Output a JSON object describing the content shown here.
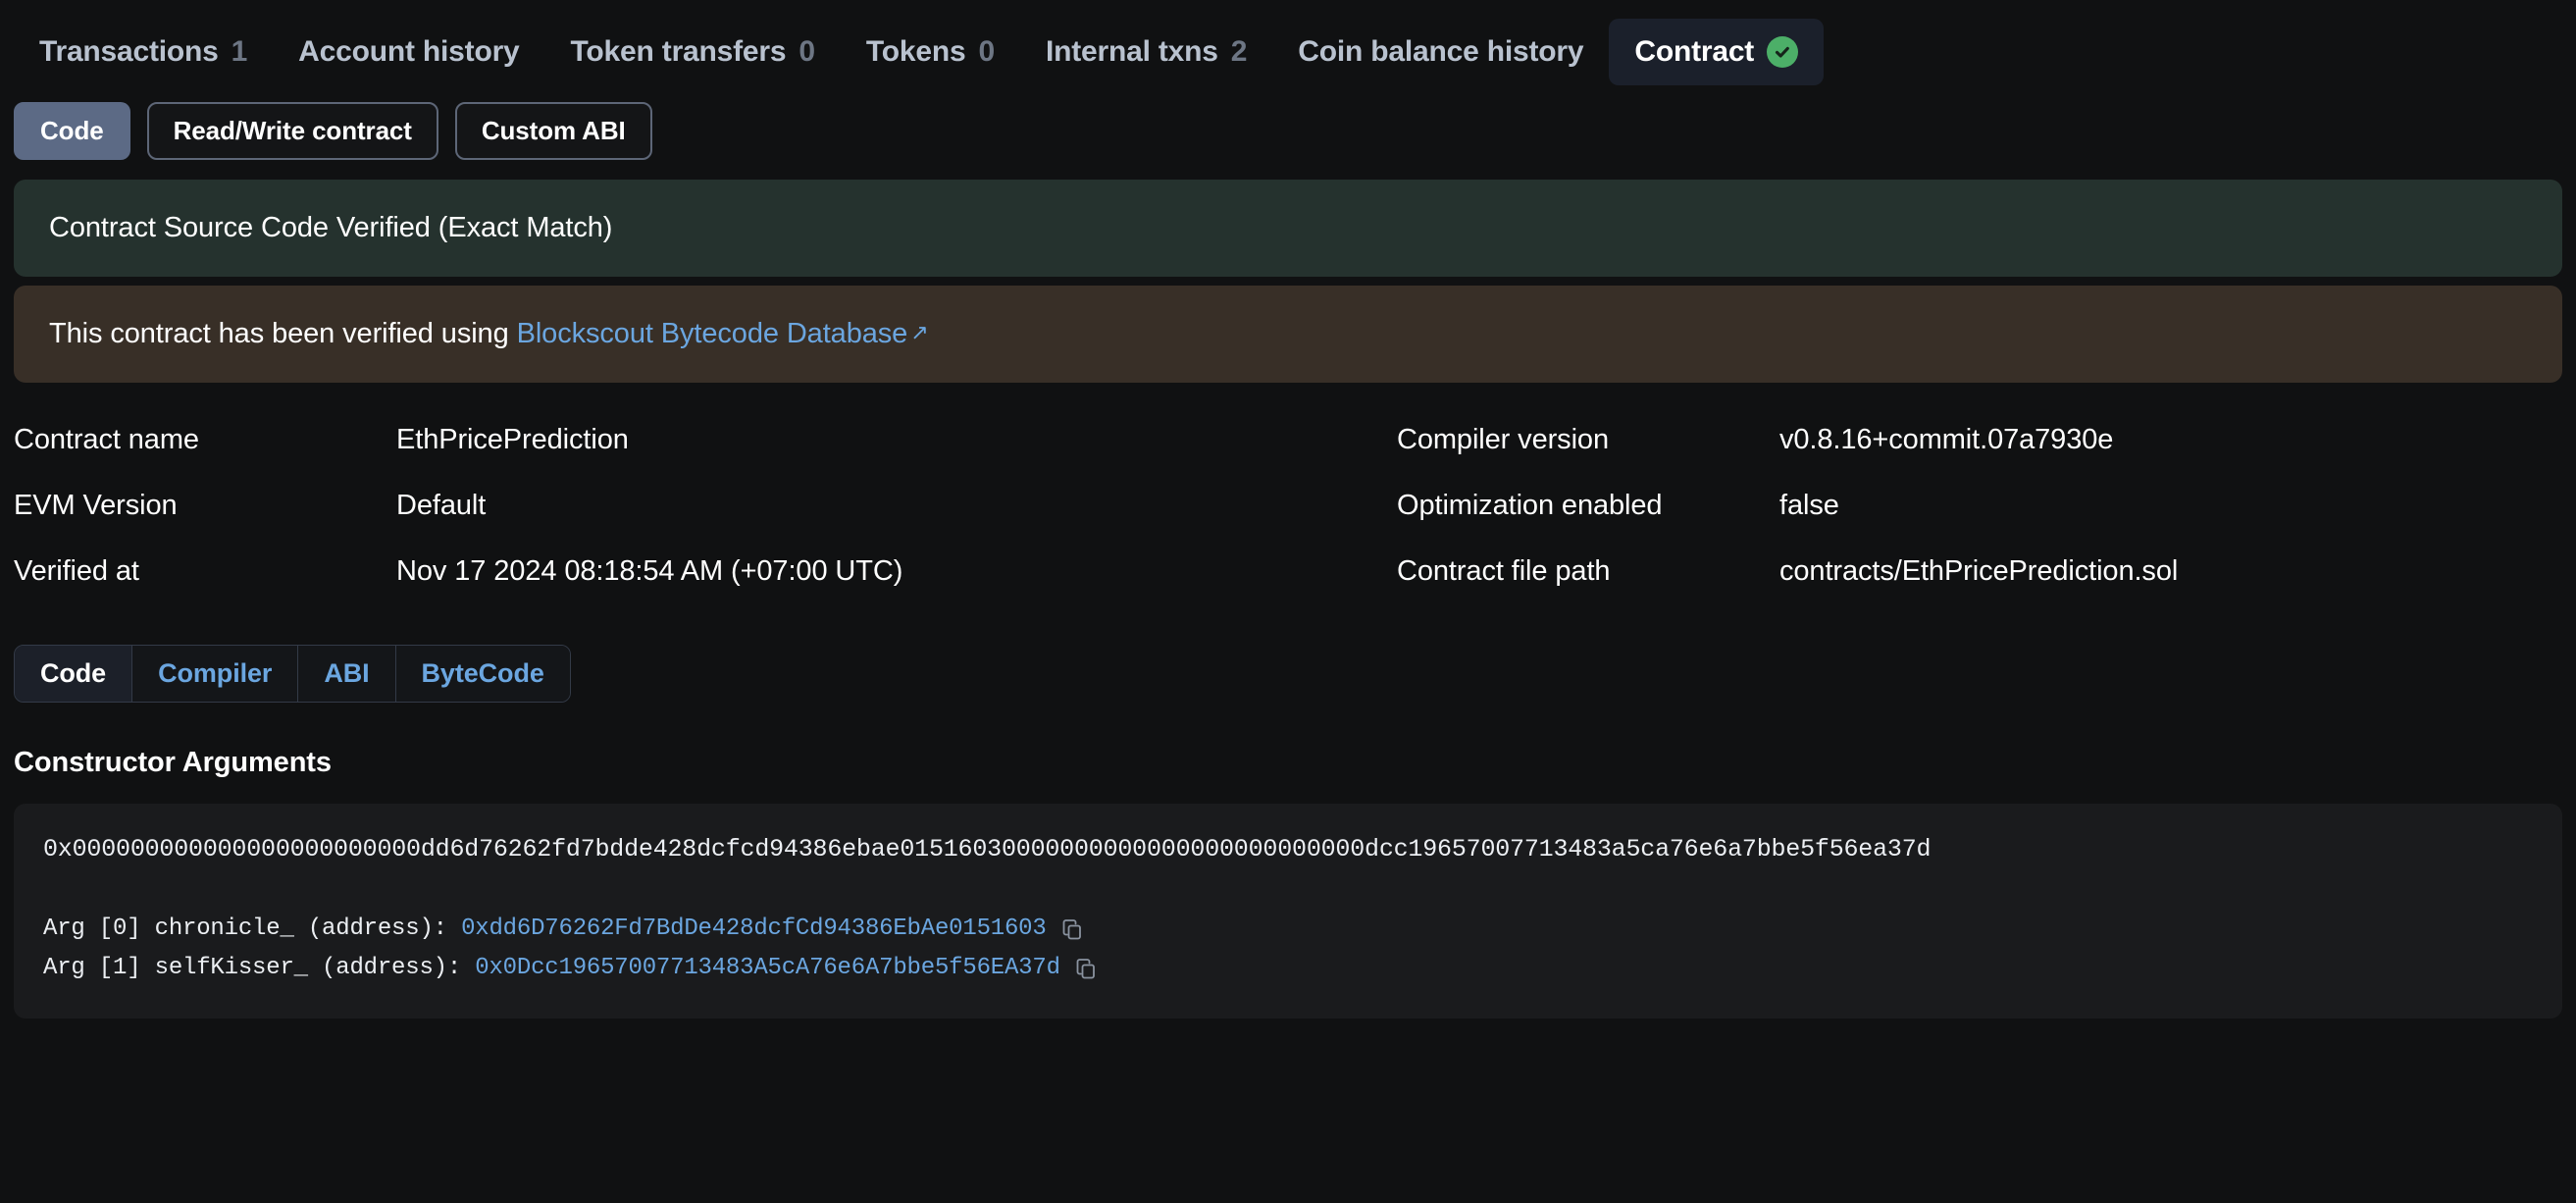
{
  "tabs": [
    {
      "label": "Transactions",
      "count": "1",
      "active": false
    },
    {
      "label": "Account history",
      "count": "",
      "active": false
    },
    {
      "label": "Token transfers",
      "count": "0",
      "active": false
    },
    {
      "label": "Tokens",
      "count": "0",
      "active": false
    },
    {
      "label": "Internal txns",
      "count": "2",
      "active": false
    },
    {
      "label": "Coin balance history",
      "count": "",
      "active": false
    },
    {
      "label": "Contract",
      "count": "",
      "active": true,
      "badge": "verified-check"
    }
  ],
  "contract_buttons": [
    {
      "label": "Code",
      "style": "filled"
    },
    {
      "label": "Read/Write contract",
      "style": "outlined"
    },
    {
      "label": "Custom ABI",
      "style": "outlined"
    }
  ],
  "banners": {
    "verified": "Contract Source Code Verified (Exact Match)",
    "bytecode_db_prefix": "This contract has been verified using ",
    "bytecode_db_link": "Blockscout Bytecode Database",
    "external_arrow": "↗"
  },
  "details": [
    {
      "key": "Contract name",
      "value": "EthPricePrediction"
    },
    {
      "key": "Compiler version",
      "value": "v0.8.16+commit.07a7930e"
    },
    {
      "key": "EVM Version",
      "value": "Default"
    },
    {
      "key": "Optimization enabled",
      "value": "false"
    },
    {
      "key": "Verified at",
      "value": "Nov 17 2024 08:18:54 AM (+07:00 UTC)"
    },
    {
      "key": "Contract file path",
      "value": "contracts/EthPricePrediction.sol"
    }
  ],
  "segmented_tabs": [
    {
      "label": "Code",
      "active": true
    },
    {
      "label": "Compiler",
      "active": false
    },
    {
      "label": "ABI",
      "active": false
    },
    {
      "label": "ByteCode",
      "active": false
    }
  ],
  "constructor": {
    "title": "Constructor Arguments",
    "raw_hex": "0x000000000000000000000000dd6d76262fd7bdde428dcfcd94386ebae01516030000000000000000000000000dcc19657007713483a5ca76e6a7bbe5f56ea37d",
    "args": [
      {
        "label": "Arg [0] chronicle_ (address): ",
        "address": "0xdd6D76262Fd7BdDe428dcfCd94386EbAe0151603",
        "copy_icon": "copy-icon"
      },
      {
        "label": "Arg [1] selfKisser_ (address): ",
        "address": "0x0Dcc19657007713483A5cA76e6A7bbe5f56EA37d",
        "copy_icon": "copy-icon"
      }
    ]
  },
  "colors": {
    "page_bg": "#101112",
    "active_tab_bg": "#1b202b",
    "verified_green": "#4caf68",
    "banner_green_bg": "#25322e",
    "banner_brown_bg": "#382f27",
    "link_blue": "#6ba6e0",
    "pill_filled_bg": "#5c6a85",
    "code_bg": "#1a1b1d"
  }
}
